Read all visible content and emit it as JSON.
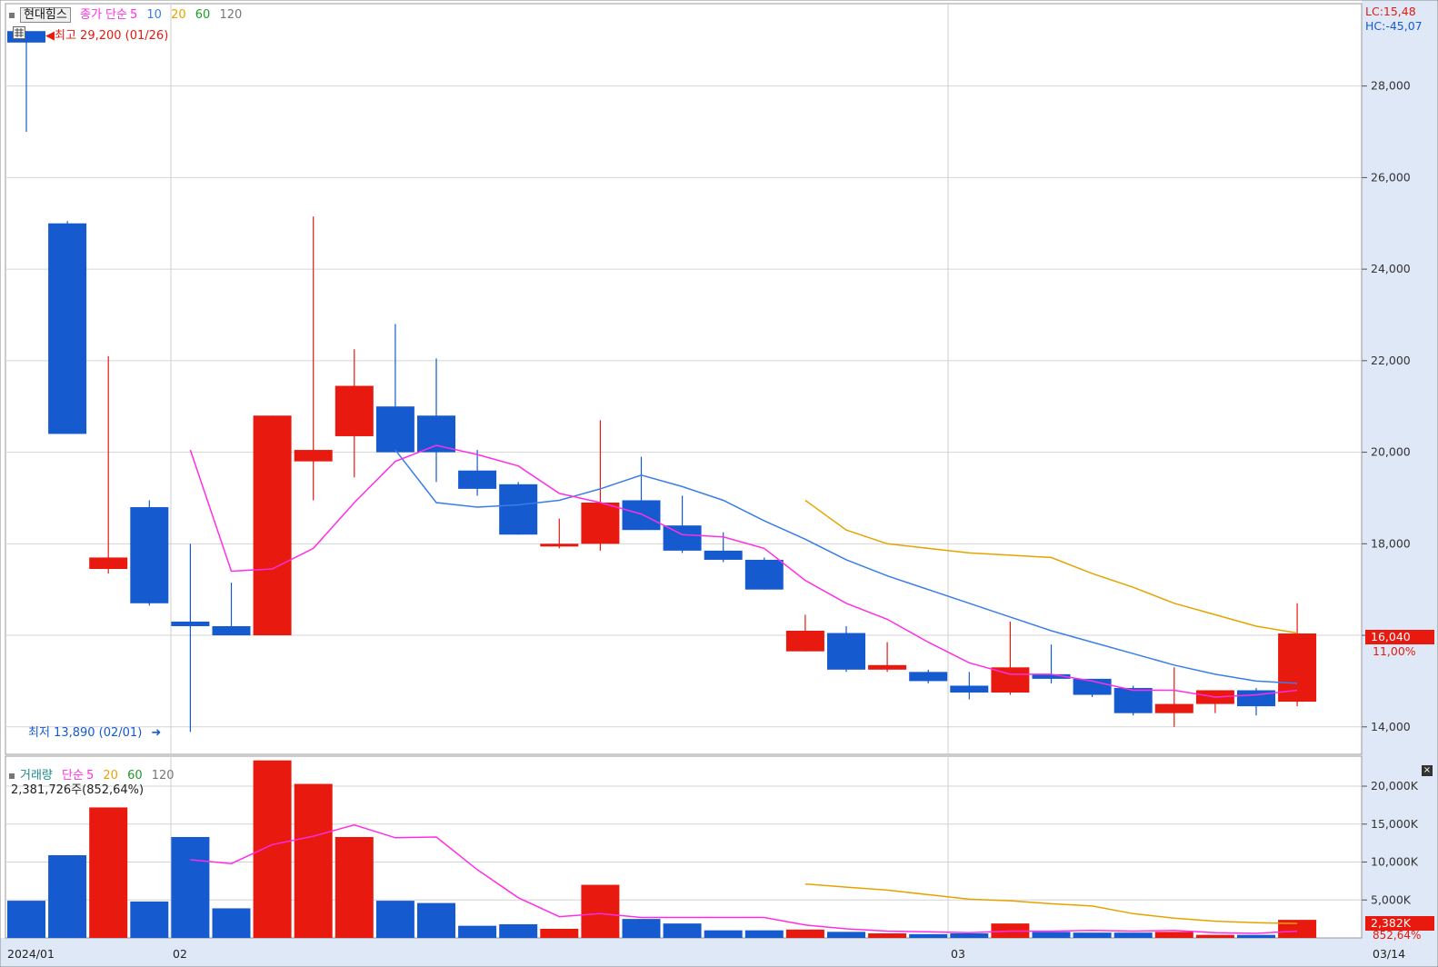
{
  "colors": {
    "up": "#e8190e",
    "down": "#165ad0",
    "ma5": "#ff2ee6",
    "ma10": "#3a7de8",
    "ma20": "#e6a300",
    "ma60": "#1f9a2a",
    "ma120": "#777777",
    "axis_bg": "#dfe8f6",
    "grid": "#d4d4d4"
  },
  "legend_price": {
    "name": "현대힘스",
    "label": "종가 단순",
    "p5": "5",
    "p10": "10",
    "p20": "20",
    "p60": "60",
    "p120": "120"
  },
  "legend_volume": {
    "label": "거래량",
    "simple": "단순",
    "p5": "5",
    "p20": "20",
    "p60": "60",
    "p120": "120",
    "current": "2,381,726주(852,64%)"
  },
  "lc_hc": {
    "lc": "LC:15,48",
    "hc": "HC:-45,07"
  },
  "annotations": {
    "high": "최고 29,200 (01/26)",
    "low": "최저 13,890 (02/01)"
  },
  "price_badge": {
    "value": "16,040",
    "pct": "11,00%"
  },
  "volume_badge": {
    "value": "2,382K",
    "pct": "852,64%"
  },
  "x_labels": {
    "start": "2024/01",
    "feb": "02",
    "mar": "03",
    "end": "03/14"
  },
  "chart_data": [
    {
      "type": "candlestick",
      "y_ticks": [
        "28,000",
        "26,000",
        "24,000",
        "22,000",
        "20,000",
        "18,000",
        "16,000",
        "14,000"
      ],
      "y_tick_values": [
        28000,
        26000,
        24000,
        22000,
        20000,
        18000,
        16000,
        14000
      ],
      "ylim": [
        13400,
        29800
      ],
      "candles": [
        {
          "o": 29200,
          "h": 29200,
          "l": 27000,
          "c": 28950
        },
        {
          "o": 25000,
          "h": 25050,
          "l": 20400,
          "c": 20400
        },
        {
          "o": 17450,
          "h": 22100,
          "l": 17350,
          "c": 17700
        },
        {
          "o": 18800,
          "h": 18950,
          "l": 16650,
          "c": 16700
        },
        {
          "o": 16300,
          "h": 18000,
          "l": 13890,
          "c": 16200
        },
        {
          "o": 16200,
          "h": 17150,
          "l": 16000,
          "c": 16000
        },
        {
          "o": 16000,
          "h": 20800,
          "l": 16000,
          "c": 20800
        },
        {
          "o": 19800,
          "h": 25150,
          "l": 18950,
          "c": 20050
        },
        {
          "o": 20350,
          "h": 22250,
          "l": 19450,
          "c": 21450
        },
        {
          "o": 21000,
          "h": 22800,
          "l": 20000,
          "c": 20000
        },
        {
          "o": 20800,
          "h": 22050,
          "l": 19350,
          "c": 20000
        },
        {
          "o": 19600,
          "h": 20050,
          "l": 19050,
          "c": 19200
        },
        {
          "o": 19300,
          "h": 19350,
          "l": 18200,
          "c": 18200
        },
        {
          "o": 17950,
          "h": 18550,
          "l": 17900,
          "c": 18000
        },
        {
          "o": 18000,
          "h": 20700,
          "l": 17850,
          "c": 18900
        },
        {
          "o": 18950,
          "h": 19900,
          "l": 18300,
          "c": 18300
        },
        {
          "o": 18400,
          "h": 19050,
          "l": 17800,
          "c": 17850
        },
        {
          "o": 17850,
          "h": 18250,
          "l": 17600,
          "c": 17650
        },
        {
          "o": 17650,
          "h": 17700,
          "l": 17000,
          "c": 17000
        },
        {
          "o": 15650,
          "h": 16450,
          "l": 15650,
          "c": 16100
        },
        {
          "o": 16050,
          "h": 16200,
          "l": 15200,
          "c": 15250
        },
        {
          "o": 15250,
          "h": 15850,
          "l": 15200,
          "c": 15350
        },
        {
          "o": 15200,
          "h": 15250,
          "l": 14950,
          "c": 15000
        },
        {
          "o": 14900,
          "h": 15200,
          "l": 14600,
          "c": 14750
        },
        {
          "o": 14750,
          "h": 16300,
          "l": 14700,
          "c": 15300
        },
        {
          "o": 15150,
          "h": 15800,
          "l": 14950,
          "c": 15050
        },
        {
          "o": 15050,
          "h": 15050,
          "l": 14650,
          "c": 14700
        },
        {
          "o": 14850,
          "h": 14900,
          "l": 14250,
          "c": 14300
        },
        {
          "o": 14300,
          "h": 15300,
          "l": 14000,
          "c": 14500
        },
        {
          "o": 14500,
          "h": 14800,
          "l": 14300,
          "c": 14800
        },
        {
          "o": 14800,
          "h": 14850,
          "l": 14250,
          "c": 14450
        },
        {
          "o": 14550,
          "h": 16700,
          "l": 14450,
          "c": 16040
        }
      ],
      "ma5": [
        null,
        null,
        null,
        null,
        20050,
        17400,
        17450,
        17900,
        18900,
        19800,
        20150,
        19950,
        19700,
        19100,
        18900,
        18650,
        18200,
        18150,
        17900,
        17200,
        16700,
        16350,
        15850,
        15400,
        15150,
        15150,
        15000,
        14800,
        14800,
        14650,
        14700,
        14800
      ],
      "ma10": [
        null,
        null,
        null,
        null,
        null,
        null,
        null,
        null,
        null,
        20050,
        18900,
        18800,
        18850,
        18950,
        19200,
        19500,
        19250,
        18950,
        18500,
        18100,
        17650,
        17300,
        17000,
        16700,
        16400,
        16100,
        15850,
        15600,
        15350,
        15150,
        15000,
        14950
      ],
      "ma20": [
        null,
        null,
        null,
        null,
        null,
        null,
        null,
        null,
        null,
        null,
        null,
        null,
        null,
        null,
        null,
        null,
        null,
        null,
        null,
        18950,
        18300,
        18000,
        17900,
        17800,
        17750,
        17700,
        17350,
        17050,
        16700,
        16450,
        16200,
        16050
      ]
    },
    {
      "type": "bar",
      "y_ticks": [
        "20,000K",
        "15,000K",
        "10,000K",
        "5,000K"
      ],
      "y_tick_values": [
        20000,
        15000,
        10000,
        5000
      ],
      "ylim": [
        0,
        23000
      ],
      "volume": [
        4900,
        10900,
        17200,
        4800,
        13300,
        3900,
        23400,
        20300,
        13300,
        4900,
        4600,
        1600,
        1800,
        1200,
        7000,
        2500,
        1900,
        1000,
        1000,
        1100,
        800,
        600,
        500,
        600,
        1900,
        800,
        700,
        700,
        800,
        400,
        400,
        2382
      ],
      "ma5": [
        null,
        null,
        null,
        null,
        10300,
        9800,
        12300,
        13400,
        14900,
        13200,
        13300,
        9000,
        5300,
        2800,
        3200,
        2700,
        2700,
        2700,
        2700,
        1700,
        1200,
        900,
        800,
        700,
        900,
        900,
        1000,
        900,
        1000,
        700,
        600,
        900
      ],
      "ma20": [
        null,
        null,
        null,
        null,
        null,
        null,
        null,
        null,
        null,
        null,
        null,
        null,
        null,
        null,
        null,
        null,
        null,
        null,
        null,
        7100,
        6700,
        6300,
        5700,
        5100,
        4900,
        4500,
        4200,
        3200,
        2600,
        2200,
        2000,
        1900
      ]
    }
  ]
}
